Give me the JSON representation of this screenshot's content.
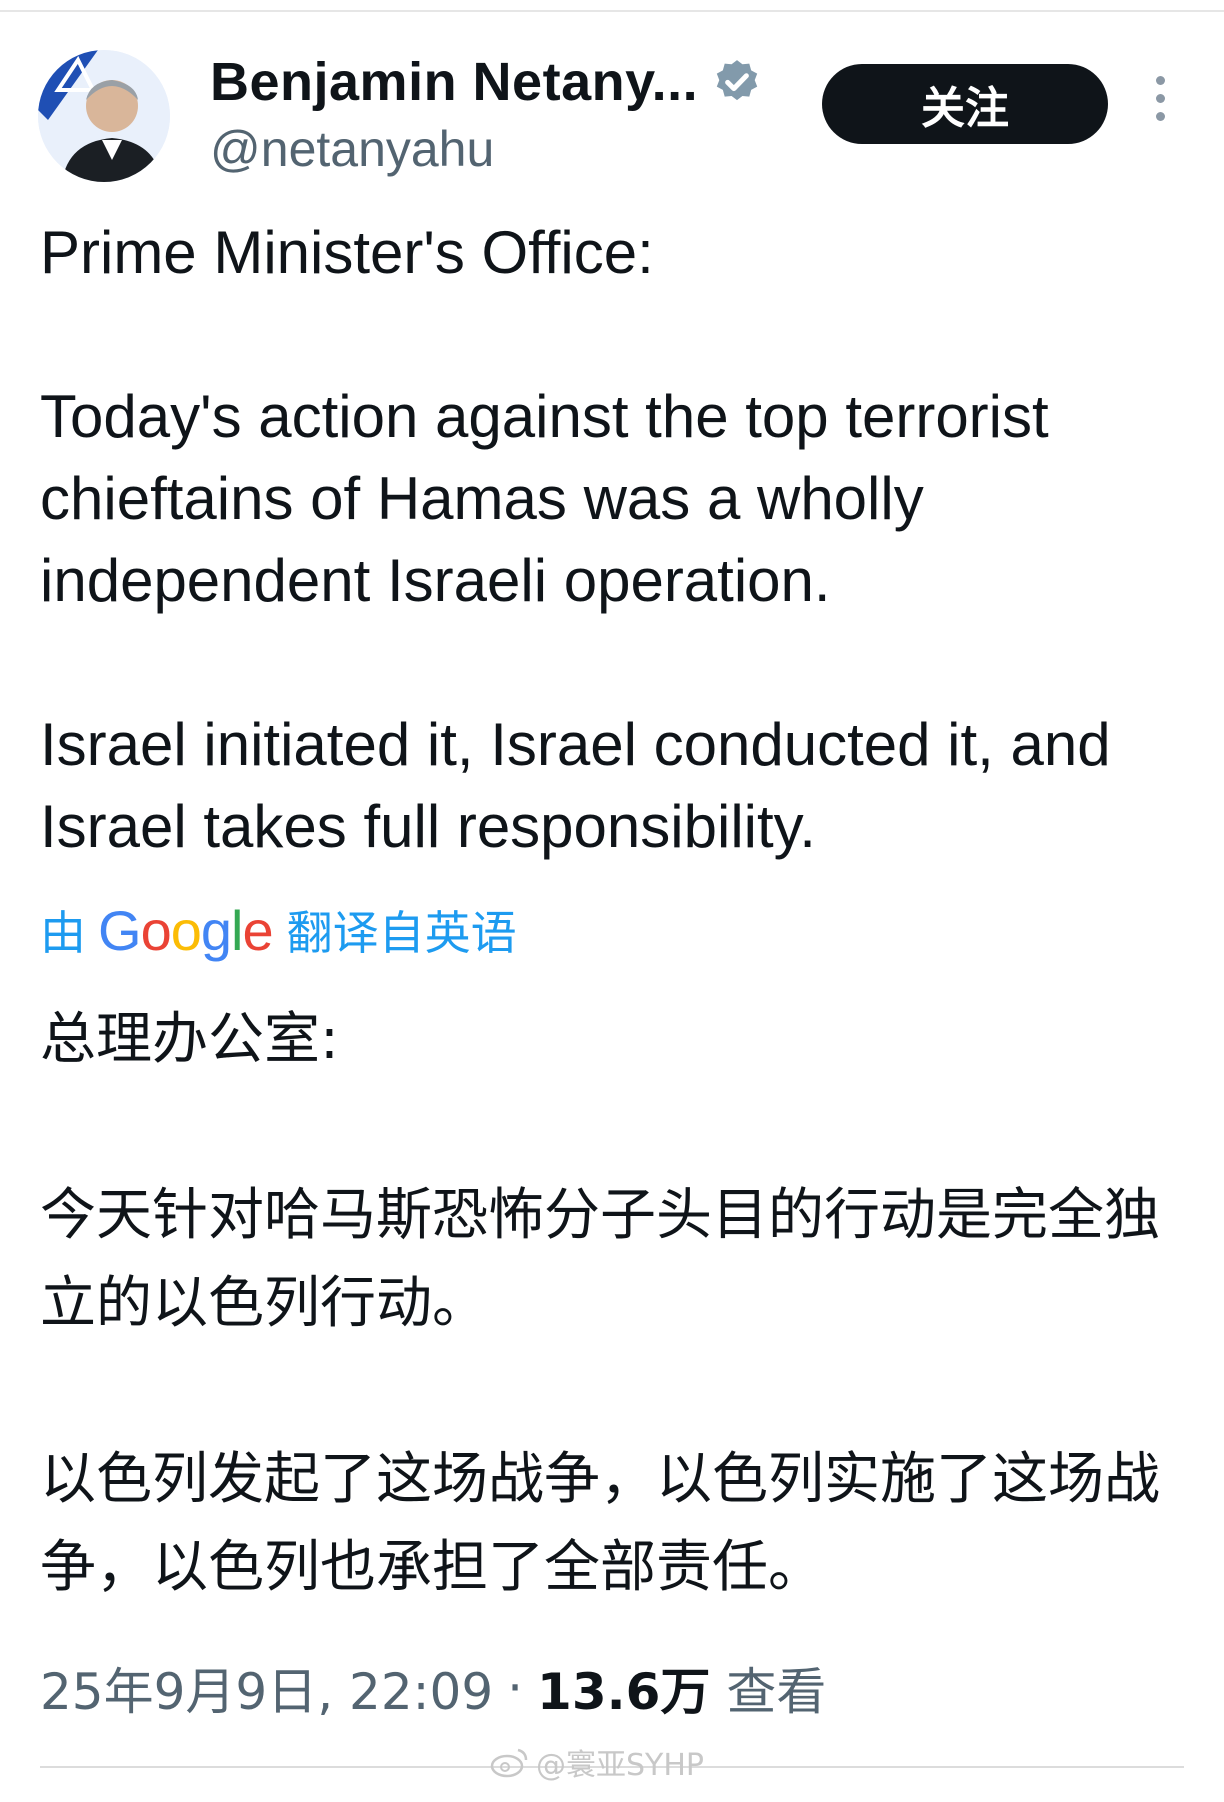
{
  "header": {
    "display_name": "Benjamin Netany...",
    "handle": "@netanyahu",
    "follow_label": "关注"
  },
  "tweet": {
    "paragraphs": [
      "Prime Minister's Office:",
      "Today's action against the top terrorist chieftains of Hamas was a wholly independent Israeli operation.",
      "Israel initiated it, Israel conducted it, and Israel takes full responsibility."
    ]
  },
  "translation": {
    "prefix": "由",
    "provider": "Google",
    "suffix": "翻译自英语",
    "paragraphs": [
      "总理办公室:",
      "今天针对哈马斯恐怖分子头目的行动是完全独立的以色列行动。",
      "以色列发起了这场战争，以色列实施了这场战争，以色列也承担了全部责任。"
    ]
  },
  "meta": {
    "timestamp": "25年9月9日, 22:09",
    "separator": "·",
    "views_count": "13.6万",
    "views_label": "查看"
  },
  "watermark": {
    "text": "@寰亚SYHP"
  },
  "colors": {
    "accent": "#1d9bf0",
    "text": "#0f1419",
    "muted": "#536471",
    "button": "#0f1419"
  }
}
